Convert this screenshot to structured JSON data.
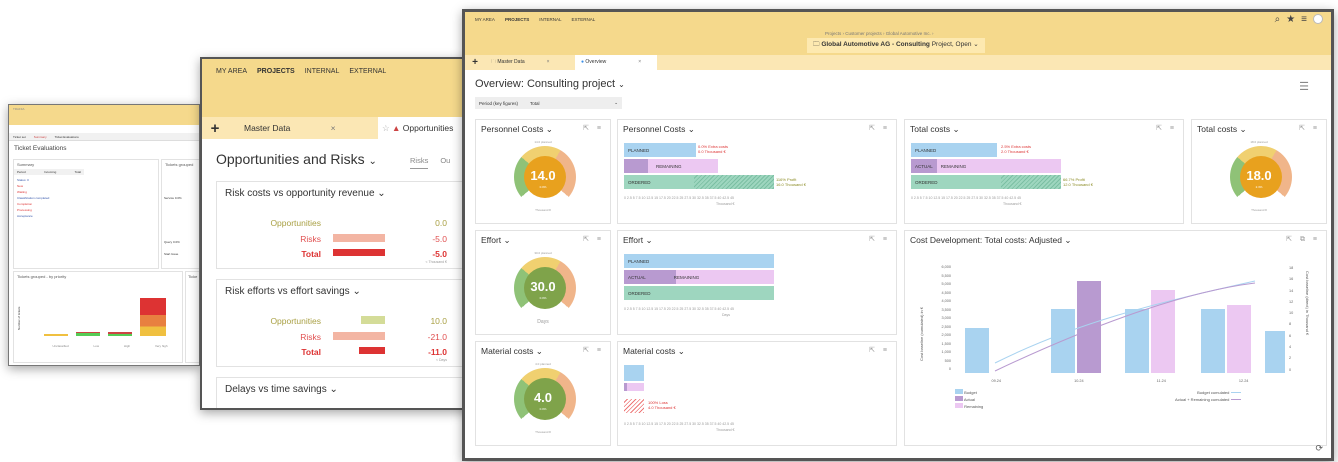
{
  "w1": {
    "brand": "TRAFFA",
    "tabs": [
      "Ticket set",
      "Summary",
      "Ticket Evaluations"
    ],
    "title": "Ticket Evaluations",
    "summary_title": "Summary",
    "tickets_grouped": "Tickets grouped",
    "col_period": "Period",
    "col_incoming": "Incoming",
    "col_total": "Total",
    "summary_rows": [
      "Status: 0",
      "New",
      "Waiting",
      "Classification completed",
      "Completion",
      "Processing",
      "Acceptance"
    ],
    "sublabels": [
      "Service 0.0%",
      "Query 0.0%",
      "Start Issue"
    ],
    "bottom_title": "Tickets grouped - by priority",
    "bottom_right": "Ticke",
    "ylabel": "Number of tickets",
    "x_labels": [
      "Unclassified",
      "Low",
      "High",
      "Very high"
    ]
  },
  "w2": {
    "nav": [
      "MY AREA",
      "PROJECTS",
      "INTERNAL",
      "EXTERNAL"
    ],
    "tab_master": "Master Data",
    "tab_opps": "Opportunities",
    "title": "Opportunities and Risks",
    "sub_tabs": [
      "Risks",
      "Ou"
    ],
    "sections": [
      {
        "title": "Risk costs vs opportunity revenue",
        "opps_label": "Opportunities",
        "opps_val": "0.0",
        "risks_label": "Risks",
        "risks_val": "-5.0",
        "total_label": "Total",
        "total_val": "-5.0",
        "unit": "< Thousand €"
      },
      {
        "title": "Risk efforts vs effort savings",
        "opps_label": "Opportunities",
        "opps_val": "10.0",
        "risks_label": "Risks",
        "risks_val": "-21.0",
        "total_label": "Total",
        "total_val": "-11.0",
        "unit": "< Days"
      },
      {
        "title": "Delays vs time savings"
      }
    ]
  },
  "w3": {
    "nav": [
      "MY AREA",
      "PROJECTS",
      "INTERNAL",
      "EXTERNAL"
    ],
    "breadcrumb": "Projects  ›  Customer projects  ›  Global Automotive Inc.  ›",
    "project": "Global Automotive AG - Consulting",
    "project_status": "Project, Open",
    "tab_master": "Master Data",
    "tab_overview": "Overview",
    "title": "Overview: Consulting project",
    "period_label": "Period (key figures)",
    "period_value": "Total",
    "personnel_gauge": {
      "title": "Personnel Costs",
      "value": "14.0",
      "pct": "0.0%",
      "planned": "14.0 planned",
      "unit": "Thousand €"
    },
    "personnel_bar": {
      "title": "Personnel Costs",
      "rows": [
        "PLANNED",
        "REMAINING",
        "ORDERED"
      ],
      "note1": "0.0% Extra costs",
      "note1b": "0.0 Thousand €",
      "note2": "116% Profit",
      "note2b": "16.0 Thousand €",
      "axis": "0  2.5  5  7.5  10  12.5  15  17.5  20  22.5  25  27.5  30  32.5  35  37.5  40  42.5  45",
      "unit": "Thousand €"
    },
    "total_bar": {
      "title": "Total costs",
      "rows": [
        "PLANNED",
        "ACTUAL",
        "REMAINING",
        "ORDERED"
      ],
      "note1": "2.5% Extra costs",
      "note1b": "2.0 Thousand €",
      "note2": "66.7% Profit",
      "note2b": "12.0 Thousand €",
      "axis": "0  2.5  5  7.5  10  12.5  15  17.5  20  22.5  25  27.5  30  32.5  35  37.5  40  42.5  45",
      "unit": "Thousand €"
    },
    "total_gauge": {
      "title": "Total costs",
      "value": "18.0",
      "pct": "2.3%",
      "planned": "18.0 planned",
      "unit": "Thousand €"
    },
    "effort_gauge": {
      "title": "Effort",
      "value": "30.0",
      "pct": "0.0%",
      "planned": "30.0 planned",
      "unit": "Days"
    },
    "effort_bar": {
      "title": "Effort",
      "rows": [
        "PLANNED",
        "ACTUAL",
        "REMAINING",
        "ORDERED"
      ],
      "axis": "0  2.5  5  7.5  10  12.5  15  17.5  20  22.5  25  27.5  30  32.5  35  37.5  40  42.5  45",
      "unit": "Days"
    },
    "material_gauge": {
      "title": "Material costs",
      "value": "4.0",
      "pct": "0.0%",
      "planned": "4.0 planned",
      "unit": "Thousand €"
    },
    "material_bar": {
      "title": "Material costs",
      "note1": "100% Loss",
      "note1b": "4.0 Thousand €",
      "axis": "0  2.5  5  7.5  10  12.5  15  17.5  20  22.5  25  27.5  30  32.5  35  37.5  40  42.5  45",
      "unit": "Thousand €"
    },
    "cost_dev": {
      "title": "Cost Development: Total costs: Adjusted",
      "ylabel_left": "Cost baseline (cumulated) in €",
      "ylabel_right": "Cost baseline (direct) in Thousand €",
      "y_ticks": [
        "6,000",
        "5,500",
        "5,000",
        "4,500",
        "4,000",
        "3,500",
        "3,000",
        "2,500",
        "2,000",
        "1,500",
        "1,000",
        "500",
        "0"
      ],
      "y2_ticks": [
        "18",
        "16",
        "14",
        "12",
        "10",
        "8",
        "6",
        "4",
        "2",
        "0"
      ],
      "x_ticks": [
        "09.24",
        "10.24",
        "11.24",
        "12.24"
      ],
      "legend": [
        "Budget",
        "Actual",
        "Remaining"
      ],
      "legend_right": [
        "Budget cumulated",
        "Actual + Remaining cumulated"
      ],
      "colors": {
        "budget": "#a9d3f0",
        "actual": "#b89ad0",
        "remaining": "#ecc8f2"
      }
    }
  }
}
